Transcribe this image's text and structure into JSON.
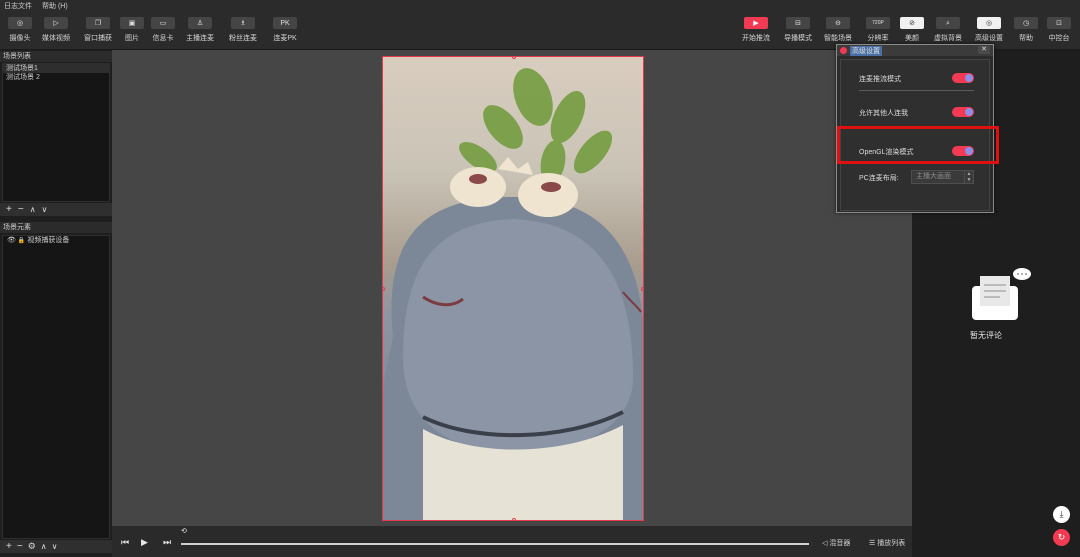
{
  "menu": [
    "日志文件",
    "帮助 (H)"
  ],
  "toolbar_left": [
    {
      "label": "摄像头",
      "icon": "camera-icon",
      "glyph": "◎"
    },
    {
      "label": "媒体视频",
      "icon": "play-icon",
      "glyph": "▷"
    },
    {
      "label": "窗口捕获",
      "icon": "window-capture-icon",
      "glyph": "❐"
    },
    {
      "label": "图片",
      "icon": "image-icon",
      "glyph": "▣"
    },
    {
      "label": "信息卡",
      "icon": "info-card-icon",
      "glyph": "▭"
    },
    {
      "label": "主播连麦",
      "icon": "anchor-link-icon",
      "glyph": "♙"
    },
    {
      "label": "粉丝连麦",
      "icon": "fan-link-icon",
      "glyph": "♗"
    },
    {
      "label": "连麦PK",
      "icon": "pk-icon",
      "glyph": "PK"
    }
  ],
  "toolbar_right": [
    {
      "label": "开始推流",
      "icon": "start-stream-icon",
      "glyph": "▶",
      "style": "red"
    },
    {
      "label": "导播模式",
      "icon": "director-mode-icon",
      "glyph": "⊟",
      "style": "normal"
    },
    {
      "label": "智能场景",
      "icon": "smart-scene-icon",
      "glyph": "⊖",
      "style": "normal"
    },
    {
      "label": "分辨率",
      "icon": "resolution-icon",
      "glyph": "720P",
      "style": "normal"
    },
    {
      "label": "美颜",
      "icon": "beauty-icon",
      "glyph": "⊘",
      "style": "white"
    },
    {
      "label": "虚拟背景",
      "icon": "search-icon",
      "glyph": "⌕",
      "style": "normal"
    },
    {
      "label": "高级设置",
      "icon": "settings-icon",
      "glyph": "◎",
      "style": "white"
    },
    {
      "label": "帮助",
      "icon": "help-icon",
      "glyph": "◷",
      "style": "normal"
    },
    {
      "label": "中控台",
      "icon": "console-icon",
      "glyph": "⊡",
      "style": "normal"
    }
  ],
  "scene_panel": {
    "title": "场景列表",
    "items": [
      "测试场景1",
      "测试场景 2"
    ]
  },
  "element_panel": {
    "title": "场景元素",
    "items": [
      "视频捕获设备"
    ]
  },
  "playbar": {
    "mixer_label": "混音器",
    "playlist_label": "播放列表"
  },
  "comments": {
    "empty_text": "暂无评论"
  },
  "dialog": {
    "title": "高级设置",
    "close": "✕",
    "options": [
      {
        "label": "连麦推流模式",
        "enabled": true
      },
      {
        "label": "允许其他人连我",
        "enabled": true
      },
      {
        "label": "OpenGL渲染模式",
        "enabled": true
      }
    ],
    "layout_label": "PC连麦布局:",
    "layout_value": "主播大画面"
  },
  "colors": {
    "accent": "#f23a52",
    "highlight": "#e01010",
    "toggle_knob": "#8e8ee8"
  }
}
